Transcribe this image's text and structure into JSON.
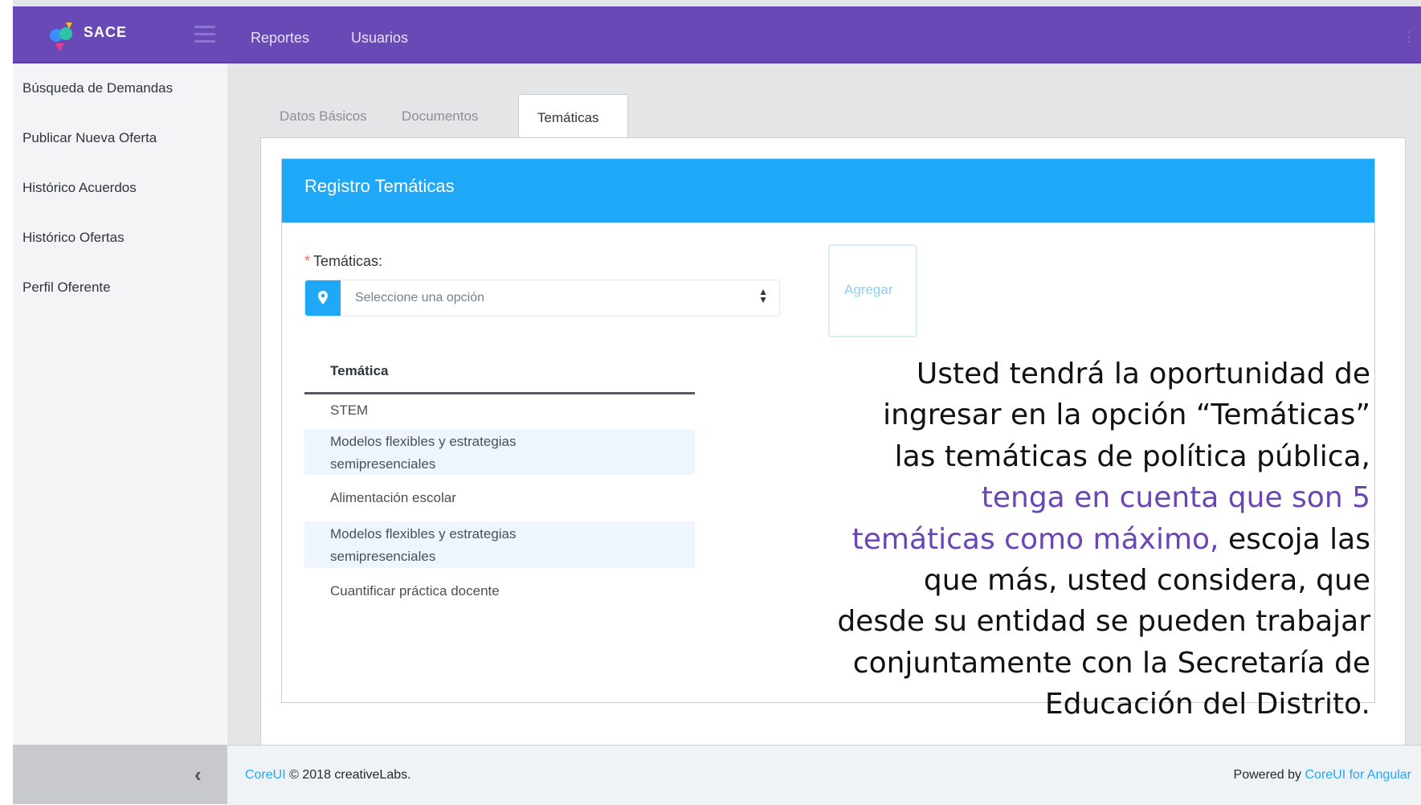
{
  "header": {
    "brand": "SACE",
    "nav": [
      "Reportes",
      "Usuarios"
    ]
  },
  "sidebar": {
    "items": [
      "Búsqueda de Demandas",
      "Publicar Nueva Oferta",
      "Histórico Acuerdos",
      "Histórico Ofertas",
      "Perfil Oferente"
    ]
  },
  "tabs": [
    "Datos Básicos",
    "Documentos",
    "Temáticas"
  ],
  "card": {
    "title": "Registro Temáticas",
    "required_mark": "*",
    "field_label": "Temáticas:",
    "select_placeholder": "Seleccione una opción",
    "add_button": "Agregar",
    "table_header": "Temática",
    "rows": [
      [
        "STEM"
      ],
      [
        "Modelos flexibles y estrategias",
        "semipresenciales"
      ],
      [
        "Alimentación escolar"
      ],
      [
        "Modelos flexibles y estrategias",
        "semipresenciales"
      ],
      [
        "Cuantificar práctica docente"
      ]
    ]
  },
  "annotation": {
    "l1": "Usted tendrá la oportunidad de",
    "l2": "ingresar en la opción “Temáticas”",
    "l3": "las temáticas de política pública,",
    "l4": "tenga en cuenta que son 5",
    "l5a": "temáticas como máximo,",
    "l5b": " escoja las",
    "l6": "que más, usted considera, que",
    "l7": "desde su entidad se pueden trabajar",
    "l8": "conjuntamente con la Secretaría de",
    "l9": "Educación del Distrito."
  },
  "footer": {
    "brand_link": "CoreUI",
    "copyright": " © 2018 creativeLabs.",
    "powered_by": "Powered by ",
    "powered_link": "CoreUI for Angular"
  },
  "colors": {
    "header": "#6849b5",
    "primary": "#20a8f8",
    "highlight": "#6b44b7"
  }
}
